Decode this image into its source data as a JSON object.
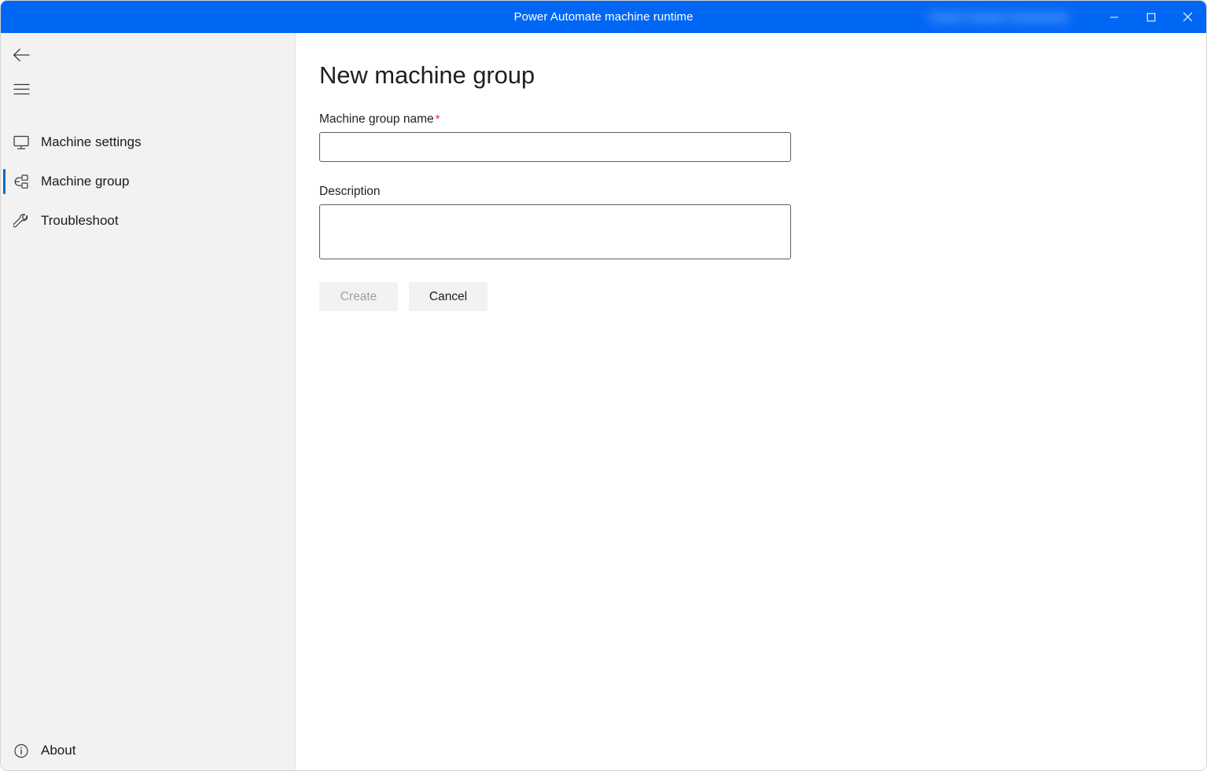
{
  "window": {
    "title": "Power Automate machine runtime",
    "identity_redacted": "Aaaaa Aaaaaa Aaaaaaaaa",
    "accent_color": "#0067f4",
    "controls": {
      "minimize": "Minimize",
      "maximize": "Maximize",
      "close": "Close"
    }
  },
  "sidebar": {
    "back_label": "Back",
    "menu_label": "Navigation menu",
    "items": [
      {
        "label": "Machine settings",
        "icon": "monitor-icon",
        "selected": false
      },
      {
        "label": "Machine group",
        "icon": "machine-group-icon",
        "selected": true
      },
      {
        "label": "Troubleshoot",
        "icon": "wrench-icon",
        "selected": false
      }
    ],
    "bottom_items": [
      {
        "label": "About",
        "icon": "info-icon"
      }
    ],
    "selection_color": "#0f6cbd",
    "background_color": "#f3f2f0"
  },
  "main": {
    "page_title": "New machine group",
    "fields": {
      "name": {
        "label": "Machine group name",
        "required_marker": "*",
        "value": "",
        "placeholder": ""
      },
      "description": {
        "label": "Description",
        "value": "",
        "placeholder": ""
      }
    },
    "buttons": {
      "create": {
        "label": "Create",
        "disabled": true
      },
      "cancel": {
        "label": "Cancel",
        "disabled": false
      }
    }
  }
}
